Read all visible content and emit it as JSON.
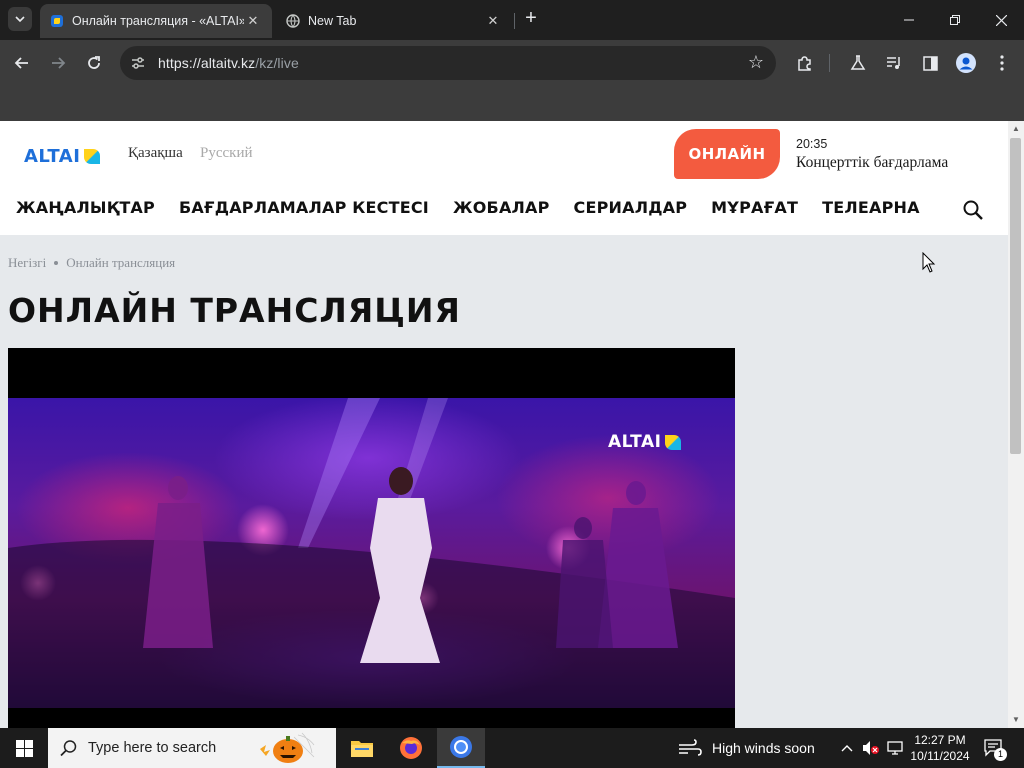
{
  "browser": {
    "tabs": [
      {
        "title": "Онлайн трансляция - «ALTAI»",
        "active": true
      },
      {
        "title": "New Tab",
        "active": false
      }
    ],
    "url_host": "https://altaitv.kz",
    "url_path": "/kz/live"
  },
  "site": {
    "logo_text": "ALTAI",
    "languages": {
      "kz": "Қазақша",
      "ru": "Русский"
    },
    "online_button": "ОНЛАЙН",
    "now_playing": {
      "time": "20:35",
      "title": "Концерттік бағдарлама"
    },
    "nav": [
      "ЖАҢАЛЫҚТАР",
      "БАҒДАРЛАМАЛАР КЕСТЕСІ",
      "ЖОБАЛАР",
      "СЕРИАЛДАР",
      "МҰРАҒАТ",
      "ТЕЛЕАРНА"
    ],
    "breadcrumb": {
      "home": "Негізгі",
      "current": "Онлайн трансляция"
    },
    "page_title": "ОНЛАЙН ТРАНСЛЯЦИЯ",
    "player_logo": "ALTAI"
  },
  "taskbar": {
    "search_placeholder": "Type here to search",
    "weather": "High winds soon",
    "time": "12:27 PM",
    "date": "10/11/2024",
    "notification_count": "1"
  },
  "colors": {
    "brand_blue": "#1e6fd9",
    "online_red": "#f35b3f"
  }
}
